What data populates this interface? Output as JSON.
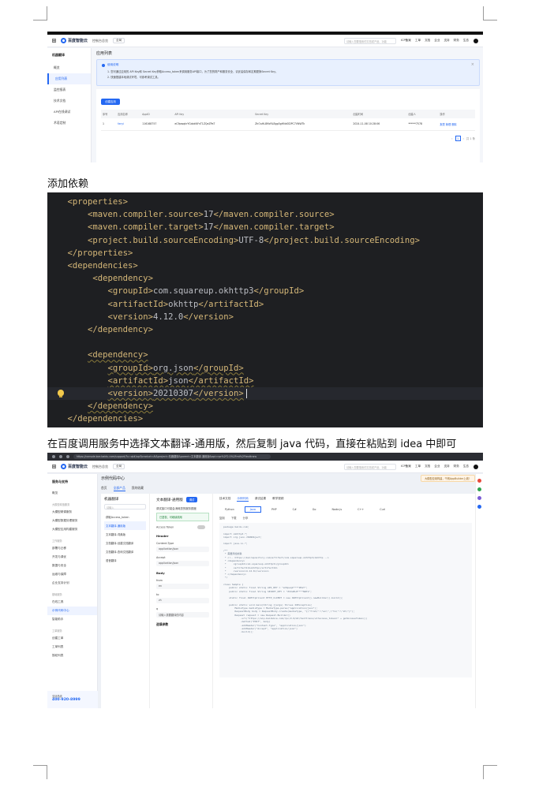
{
  "captions": {
    "add_dependency": "添加依赖",
    "instruction": "在百度调用服务中选择文本翻译-通用版，然后复制 java 代码，直接在粘贴到 idea 中即可"
  },
  "shot1": {
    "brand": "百度智能云",
    "console": "控制台总览",
    "region": "全局",
    "search_placeholder": "请输入您要搜索的文档或产品、功能",
    "topnav": [
      "ICP备案",
      "工单",
      "文档",
      "企业",
      "支持",
      "财务",
      "生态"
    ],
    "sidebar_title": "机器翻译",
    "sidebar_items": [
      "概览",
      "应用列表",
      "监控报表",
      "技术文档",
      "API在线调试",
      "术语定制"
    ],
    "page_title": "应用列表",
    "alert_title": "使用说明",
    "alert_lines": [
      "1. 您可通过应用的 API Key和 Secret Key获取Access_token来调用服务API接口，为了您的财产和服务安全，请妥善保存和定期更换Secret Key。",
      "2. 快速搭建本地调试环境，可参考调试工具。"
    ],
    "create_button": "创建应用",
    "table_headers": [
      "序号",
      "应用名称",
      "AppID",
      "API Key",
      "Secret Key",
      "创建时间",
      "创建人",
      "操作"
    ],
    "table_row": [
      "1",
      "fanyi",
      "116168757",
      "eC9pwqkrYGdxkNYnT1ZQeZPaT",
      "ZhOuHL8McRLBgp5gHNdODPC7VNWTk",
      "2024-11-08 10:28:06",
      "******7578",
      "报表 管理 删除"
    ],
    "pager_page": "1",
    "pager_total": "共 1 条"
  },
  "code_lines": [
    {
      "indent": "    ",
      "parts": [
        [
          "tg",
          "<properties>"
        ]
      ]
    },
    {
      "indent": "        ",
      "parts": [
        [
          "tg",
          "<maven.compiler.source>"
        ],
        [
          "tx",
          "17"
        ],
        [
          "tg",
          "</maven.compiler.source>"
        ]
      ]
    },
    {
      "indent": "        ",
      "parts": [
        [
          "tg",
          "<maven.compiler.target>"
        ],
        [
          "tx",
          "17"
        ],
        [
          "tg",
          "</maven.compiler.target>"
        ]
      ]
    },
    {
      "indent": "        ",
      "parts": [
        [
          "tg",
          "<project.build.sourceEncoding>"
        ],
        [
          "tx",
          "UTF-8"
        ],
        [
          "tg",
          "</project.build.sourceEncoding>"
        ]
      ]
    },
    {
      "indent": "    ",
      "parts": [
        [
          "tg",
          "</properties>"
        ]
      ]
    },
    {
      "indent": "    ",
      "parts": [
        [
          "tg",
          "<dependencies>"
        ]
      ]
    },
    {
      "indent": "         ",
      "parts": [
        [
          "tg",
          "<dependency>"
        ]
      ]
    },
    {
      "indent": "            ",
      "parts": [
        [
          "tg",
          "<groupId>"
        ],
        [
          "tx",
          "com.squareup.okhttp3"
        ],
        [
          "tg",
          "</groupId>"
        ]
      ]
    },
    {
      "indent": "            ",
      "parts": [
        [
          "tg",
          "<artifactId>"
        ],
        [
          "tx",
          "okhttp"
        ],
        [
          "tg",
          "</artifactId>"
        ]
      ]
    },
    {
      "indent": "            ",
      "parts": [
        [
          "tg",
          "<version>"
        ],
        [
          "tx",
          "4.12.0"
        ],
        [
          "tg",
          "</version>"
        ]
      ]
    },
    {
      "indent": "        ",
      "parts": [
        [
          "tg",
          "</dependency>"
        ]
      ]
    },
    {
      "indent": "",
      "parts": []
    },
    {
      "indent": "        ",
      "parts": [
        [
          "tg",
          "<dependency>"
        ]
      ],
      "squiggle": true
    },
    {
      "indent": "            ",
      "parts": [
        [
          "tg",
          "<groupId>"
        ],
        [
          "tx",
          "org.json"
        ],
        [
          "tg",
          "</groupId>"
        ]
      ],
      "squiggle": true
    },
    {
      "indent": "            ",
      "parts": [
        [
          "tg",
          "<artifactId>"
        ],
        [
          "tx",
          "json"
        ],
        [
          "tg",
          "</artifactId>"
        ]
      ],
      "squiggle": true
    },
    {
      "indent": "            ",
      "parts": [
        [
          "tg",
          "<version>"
        ],
        [
          "tx",
          "20210307"
        ],
        [
          "tg",
          "</version>"
        ]
      ],
      "squiggle": true,
      "caret": true,
      "bulb": true
    },
    {
      "indent": "        ",
      "parts": [
        [
          "tg",
          "</dependency>"
        ]
      ],
      "squiggle": true
    },
    {
      "indent": "    ",
      "parts": [
        [
          "tg",
          "</dependencies>"
        ]
      ]
    }
  ],
  "shot2": {
    "url": "https://console.bce.baidu.com/support/?u=qt#/api?product=AI&project=机器翻译&parent=文本翻译-通用版&api=rpc%2F2.0%2Fmt%2Ftexttrans",
    "brand": "百度智能云",
    "console": "控制台总览",
    "region": "全局",
    "search_placeholder": "请输入您要搜索的文档或产品、功能",
    "topnav": [
      "ICP备案",
      "工单",
      "文档",
      "企业",
      "支持",
      "财务",
      "生态"
    ],
    "sidebar_title": "服务与支持",
    "sidebar_overview": "概览",
    "groups": [
      {
        "title": "大模型增值服务",
        "items": [
          "大模型精调服务",
          "大模型数据处理服务",
          "大模型应用构建服务"
        ]
      },
      {
        "title": "工作服务",
        "items": [
          "部署与迁移",
          "开发与调优",
          "数据与安全",
          "运维与保障",
          "企业支持计划"
        ]
      },
      {
        "title": "基础服务",
        "items": [
          "在线工具",
          "示例代码中心",
          "智能助手"
        ]
      },
      {
        "title": "工单服务",
        "items": [
          "创建工单",
          "工单列表",
          "授权列表"
        ]
      }
    ],
    "active_item": "示例代码中心",
    "phone_label": "支持热线",
    "phone": "400-920-8999",
    "page_title": "示例代码中心",
    "notice": "大模型应用构建，千帆AppBuilder上线！",
    "page_tabs": [
      "首页",
      "全部产品",
      "我的收藏"
    ],
    "left_title": "机器翻译",
    "left_search": "请输入",
    "left_items": [
      "获取Access_token",
      "文本翻译-通用版",
      "文本翻译-词典版",
      "文档翻译-创建文档翻译",
      "文档翻译-查询文档翻译",
      "语音翻译"
    ],
    "mid_title": "文本翻译-通用版",
    "debug_button": "调试",
    "mid_desc": "调试接口可能会消耗您的服务额度",
    "auth_ok": "已鉴权，可继续调用",
    "auth_label": "Access Token",
    "header_label": "Header",
    "content_type_label": "Content-Type",
    "content_type_value": "application/json",
    "accept_label": "Accept",
    "accept_value": "application/json",
    "body_label": "Body",
    "from_label": "from",
    "from_value": "en",
    "to_label": "to",
    "to_value": "zh",
    "q_label": "q",
    "q_placeholder": "请输入需要翻译的内容",
    "opt_label": "选填参数",
    "code_tabs": [
      "技术文档",
      "示例代码",
      "调试结果",
      "教学视频"
    ],
    "langs": [
      "Python",
      "Java",
      "PHP",
      "C#",
      "Go",
      "Node.js",
      "C++",
      "Curl"
    ],
    "actions": [
      "复制",
      "下载",
      "分享"
    ],
    "code_sample": "package baidu.com;\n\nimport okhttp3.*;\nimport org.json.JSONObject;\n\nimport java.io.*;\n\n/**\n * 需要添加依赖\n * <!-- https://mvnrepository.com/artifact/com.squareup.okhttp3/okhttp -->\n * <dependency>\n *     <groupId>com.squareup.okhttp3</groupId>\n *     <artifactId>okhttp</artifactId>\n *     <version>4.12.0</version>\n * </dependency>\n */\n\nclass Sample {\n    public static final String API_KEY = \"eC9pwqk****ZPaT\";\n    public static final String SECRET_KEY = \"ZhOuHL8****NWTk\";\n\n    static final OkHttpClient HTTP_CLIENT = new OkHttpClient().newBuilder().build();\n\n    public static void main(String []args) throws IOException{\n        MediaType mediaType = MediaType.parse(\"application/json\");\n        RequestBody body = RequestBody.create(mediaType, \"{\\\"from\\\":\\\"en\\\",\\\"to\\\":\\\"zh\\\"}\");\n        Request request = new Request.Builder()\n            .url(\"https://aip.baidubce.com/rpc/2.0/mt/texttrans/v1?access_token=\" + getAccessToken())\n            .method(\"POST\", body)\n            .addHeader(\"Content-Type\", \"application/json\")\n            .addHeader(\"Accept\", \"application/json\")\n            .build();"
  },
  "colors": {
    "accent": "#2468f2",
    "code_bg": "#1e1f22",
    "code_tag": "#d5b778",
    "code_text": "#bcbec4"
  }
}
